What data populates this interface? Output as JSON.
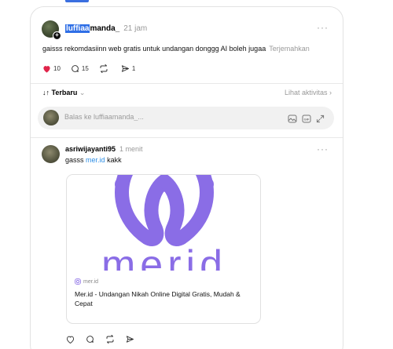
{
  "post": {
    "username_highlight": "luffiaa",
    "username_rest": "manda_",
    "time": "21 jam",
    "text": "gaisss rekomdasiinn web gratis untuk undangan donggg AI boleh jugaa",
    "translate_label": "Terjemahkan",
    "likes": "10",
    "comments": "15",
    "shares": "1"
  },
  "sort": {
    "label": "Terbaru",
    "activity_label": "Lihat aktivitas"
  },
  "reply": {
    "placeholder": "Balas ke luffiaamanda_..."
  },
  "comment": {
    "username": "asriwijayanti95",
    "time": "1 menit",
    "text_prefix": "gasss",
    "link_text": "mer.id",
    "text_suffix": "kakk",
    "card": {
      "image_text": "merid",
      "domain": "mer.id",
      "title": "Mer.id - Undangan Nikah Online Digital Gratis, Mudah & Cepat"
    }
  },
  "colors": {
    "accent_blue": "#2f6fe6",
    "link_blue": "#2f8fe6",
    "heart_red": "#e0244a",
    "logo_purple": "#8a6de6"
  },
  "icons": {
    "post_actions": [
      "heart-icon",
      "comment-icon",
      "repost-icon",
      "share-icon"
    ],
    "reply_tools": [
      "image-icon",
      "gif-icon",
      "expand-icon"
    ],
    "comment_actions": [
      "heart-icon",
      "comment-icon",
      "repost-icon",
      "share-icon"
    ]
  }
}
